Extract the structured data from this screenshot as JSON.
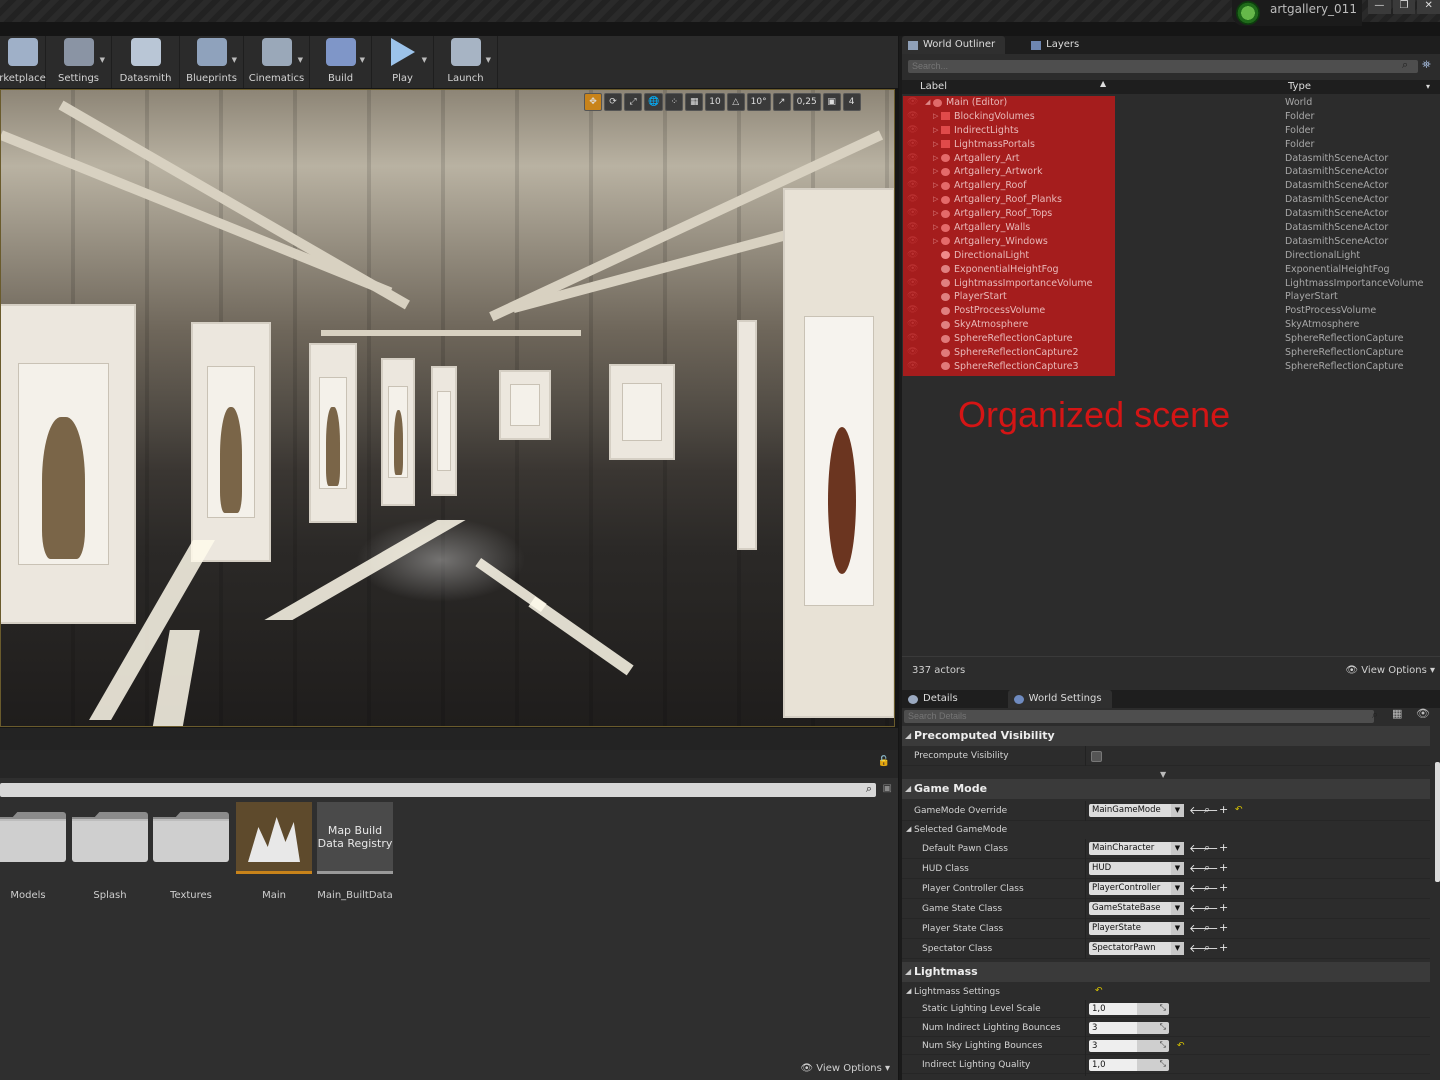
{
  "window": {
    "project_name": "artgallery_011",
    "buttons": [
      "—",
      "❐",
      "✕"
    ]
  },
  "toolbar": {
    "items": [
      {
        "label": "rketplace",
        "icon": "marketplace-icon",
        "dropdown": false,
        "color": "#9fb0c8"
      },
      {
        "label": "Settings",
        "icon": "settings-icon",
        "dropdown": true,
        "color": "#8a94a4"
      },
      {
        "label": "Datasmith",
        "icon": "datasmith-icon",
        "dropdown": false,
        "color": "#b9c6d6"
      },
      {
        "label": "Blueprints",
        "icon": "blueprints-icon",
        "dropdown": true,
        "color": "#8fa2bc"
      },
      {
        "label": "Cinematics",
        "icon": "cinematics-icon",
        "dropdown": true,
        "color": "#9aa8b9"
      },
      {
        "label": "Build",
        "icon": "build-icon",
        "dropdown": true,
        "color": "#7f96c8"
      },
      {
        "label": "Play",
        "icon": "play-icon",
        "dropdown": true,
        "color": "#9cc3ea"
      },
      {
        "label": "Launch",
        "icon": "launch-icon",
        "dropdown": true,
        "color": "#a7b4c4"
      }
    ]
  },
  "viewport": {
    "controls": [
      "✥",
      "⟳",
      "⤢",
      "🌐",
      "⁘",
      "▦",
      "10",
      "△",
      "10°",
      "↗",
      "0,25",
      "▣",
      "4"
    ]
  },
  "content_browser": {
    "items": [
      {
        "label": "Models",
        "kind": "folder"
      },
      {
        "label": "Splash",
        "kind": "folder"
      },
      {
        "label": "Textures",
        "kind": "folder"
      },
      {
        "label": "Main",
        "kind": "map"
      },
      {
        "label": "Main_BuiltData",
        "kind": "builtdata",
        "thumb_text": "Map Build Data Registry"
      }
    ],
    "view_options": "View Options"
  },
  "outliner": {
    "tabs": [
      "World Outliner",
      "Layers"
    ],
    "search_placeholder": "Search...",
    "columns": {
      "label": "Label",
      "type": "Type"
    },
    "rows": [
      {
        "label": "Main (Editor)",
        "type": "World",
        "icon": "world-icon",
        "level": 0
      },
      {
        "label": "BlockingVolumes",
        "type": "Folder",
        "icon": "folder-icon",
        "level": 1
      },
      {
        "label": "IndirectLights",
        "type": "Folder",
        "icon": "folder-icon",
        "level": 1
      },
      {
        "label": "LightmassPortals",
        "type": "Folder",
        "icon": "folder-icon",
        "level": 1
      },
      {
        "label": "Artgallery_Art",
        "type": "DatasmithSceneActor",
        "icon": "datasmith-actor-icon",
        "level": 1
      },
      {
        "label": "Artgallery_Artwork",
        "type": "DatasmithSceneActor",
        "icon": "datasmith-actor-icon",
        "level": 1
      },
      {
        "label": "Artgallery_Roof",
        "type": "DatasmithSceneActor",
        "icon": "datasmith-actor-icon",
        "level": 1
      },
      {
        "label": "Artgallery_Roof_Planks",
        "type": "DatasmithSceneActor",
        "icon": "datasmith-actor-icon",
        "level": 1
      },
      {
        "label": "Artgallery_Roof_Tops",
        "type": "DatasmithSceneActor",
        "icon": "datasmith-actor-icon",
        "level": 1
      },
      {
        "label": "Artgallery_Walls",
        "type": "DatasmithSceneActor",
        "icon": "datasmith-actor-icon",
        "level": 1
      },
      {
        "label": "Artgallery_Windows",
        "type": "DatasmithSceneActor",
        "icon": "datasmith-actor-icon",
        "level": 1
      },
      {
        "label": "DirectionalLight",
        "type": "DirectionalLight",
        "icon": "light-icon",
        "level": 1
      },
      {
        "label": "ExponentialHeightFog",
        "type": "ExponentialHeightFog",
        "icon": "fog-icon",
        "level": 1
      },
      {
        "label": "LightmassImportanceVolume",
        "type": "LightmassImportanceVolume",
        "icon": "volume-icon",
        "level": 1
      },
      {
        "label": "PlayerStart",
        "type": "PlayerStart",
        "icon": "player-start-icon",
        "level": 1
      },
      {
        "label": "PostProcessVolume",
        "type": "PostProcessVolume",
        "icon": "volume-icon",
        "level": 1
      },
      {
        "label": "SkyAtmosphere",
        "type": "SkyAtmosphere",
        "icon": "sky-icon",
        "level": 1
      },
      {
        "label": "SphereReflectionCapture",
        "type": "SphereReflectionCapture",
        "icon": "sphere-icon",
        "level": 1
      },
      {
        "label": "SphereReflectionCapture2",
        "type": "SphereReflectionCapture",
        "icon": "sphere-icon",
        "level": 1
      },
      {
        "label": "SphereReflectionCapture3",
        "type": "SphereReflectionCapture",
        "icon": "sphere-icon",
        "level": 1
      }
    ],
    "annotation": "Organized scene",
    "actor_count": "337 actors",
    "view_options": "View Options"
  },
  "details": {
    "tabs": [
      "Details",
      "World Settings"
    ],
    "search_placeholder": "Search Details",
    "sections": {
      "precomputed_visibility": {
        "title": "Precomputed Visibility",
        "precompute_label": "Precompute Visibility"
      },
      "game_mode": {
        "title": "Game Mode",
        "override_label": "GameMode Override",
        "override_value": "MainGameMode",
        "selected_label": "Selected GameMode",
        "rows": [
          {
            "label": "Default Pawn Class",
            "value": "MainCharacter"
          },
          {
            "label": "HUD Class",
            "value": "HUD"
          },
          {
            "label": "Player Controller Class",
            "value": "PlayerController"
          },
          {
            "label": "Game State Class",
            "value": "GameStateBase"
          },
          {
            "label": "Player State Class",
            "value": "PlayerState"
          },
          {
            "label": "Spectator Class",
            "value": "SpectatorPawn"
          }
        ]
      },
      "lightmass": {
        "title": "Lightmass",
        "settings_label": "Lightmass Settings",
        "rows": [
          {
            "label": "Static Lighting Level Scale",
            "value": "1,0",
            "reset": false
          },
          {
            "label": "Num Indirect Lighting Bounces",
            "value": "3",
            "reset": false
          },
          {
            "label": "Num Sky Lighting Bounces",
            "value": "3",
            "reset": true
          },
          {
            "label": "Indirect Lighting Quality",
            "value": "1,0",
            "reset": false
          }
        ]
      }
    }
  },
  "colors": {
    "accent": "#c8831a",
    "highlight": "#b21c1c",
    "annotation": "#d41515"
  }
}
